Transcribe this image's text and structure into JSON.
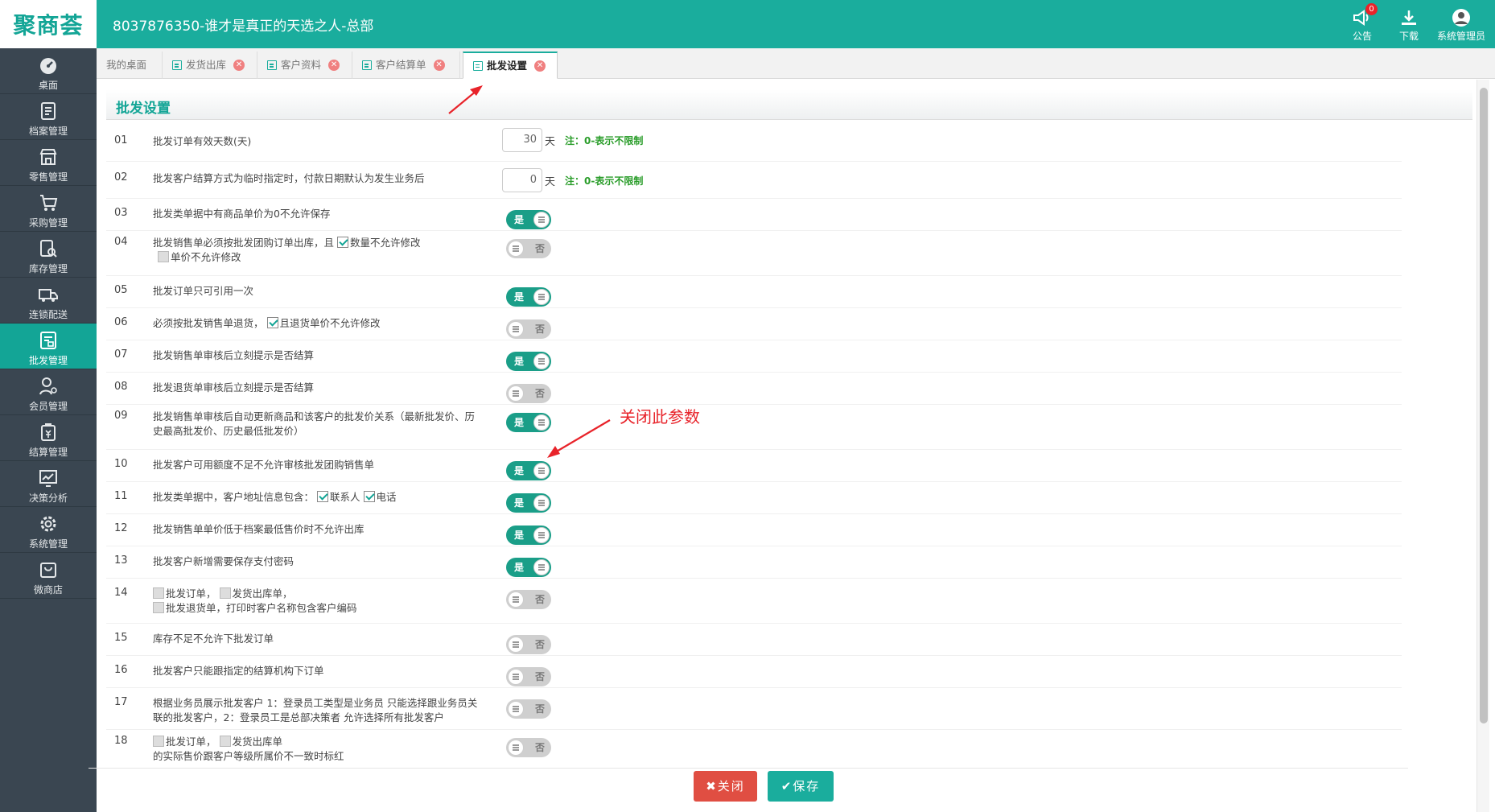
{
  "header": {
    "logo": "聚商荟",
    "company": "8037876350-谁才是真正的天选之人-总部",
    "notice_label": "公告",
    "notice_count": "0",
    "download_label": "下载",
    "user_label": "系统管理员"
  },
  "sidebar": {
    "items": [
      {
        "label": "桌面",
        "icon": "dashboard-icon"
      },
      {
        "label": "档案管理",
        "icon": "archive-icon"
      },
      {
        "label": "零售管理",
        "icon": "store-icon"
      },
      {
        "label": "采购管理",
        "icon": "cart-icon"
      },
      {
        "label": "库存管理",
        "icon": "inventory-icon"
      },
      {
        "label": "连锁配送",
        "icon": "truck-icon"
      },
      {
        "label": "批发管理",
        "icon": "wholesale-icon"
      },
      {
        "label": "会员管理",
        "icon": "member-icon"
      },
      {
        "label": "结算管理",
        "icon": "settle-icon"
      },
      {
        "label": "决策分析",
        "icon": "chart-icon"
      },
      {
        "label": "系统管理",
        "icon": "gear-icon"
      },
      {
        "label": "微商店",
        "icon": "shop-bag-icon"
      }
    ],
    "active_index": 6
  },
  "tabs": [
    {
      "label": "我的桌面",
      "closable": false
    },
    {
      "label": "发货出库",
      "closable": true
    },
    {
      "label": "客户资料",
      "closable": true
    },
    {
      "label": "客户结算单",
      "closable": true
    },
    {
      "label": "批发设置",
      "closable": true,
      "active": true
    }
  ],
  "section_title": "批发设置",
  "settings": {
    "r01": {
      "num": "01",
      "text": "批发订单有效天数(天)",
      "value": "30",
      "unit": "天",
      "note": "注：0-表示不限制"
    },
    "r02": {
      "num": "02",
      "text": "批发客户结算方式为临时指定时，付款日期默认为发生业务后",
      "value": "0",
      "unit": "天",
      "note": "注：0-表示不限制"
    },
    "r03": {
      "num": "03",
      "text": "批发类单据中有商品单价为0不允许保存",
      "state": "是"
    },
    "r04": {
      "num": "04",
      "text_a": "批发销售单必须按批发团购订单出库，且",
      "cb1": "数量不允许修改",
      "cb2": "单价不允许修改",
      "state": "否"
    },
    "r05": {
      "num": "05",
      "text": "批发订单只可引用一次",
      "state": "是"
    },
    "r06": {
      "num": "06",
      "text_a": "必须按批发销售单退货，",
      "cb1": "且退货单价不允许修改",
      "state": "否"
    },
    "r07": {
      "num": "07",
      "text": "批发销售单审核后立刻提示是否结算",
      "state": "是"
    },
    "r08": {
      "num": "08",
      "text": "批发退货单审核后立刻提示是否结算",
      "state": "否"
    },
    "r09": {
      "num": "09",
      "text": "批发销售单审核后自动更新商品和该客户的批发价关系（最新批发价、历史最高批发价、历史最低批发价）",
      "state": "是"
    },
    "r10": {
      "num": "10",
      "text": "批发客户可用额度不足不允许审核批发团购销售单",
      "state": "是"
    },
    "r11": {
      "num": "11",
      "text_a": "批发类单据中，客户地址信息包含：",
      "cb1": "联系人",
      "cb2": "电话",
      "state": "是"
    },
    "r12": {
      "num": "12",
      "text": "批发销售单单价低于档案最低售价时不允许出库",
      "state": "是"
    },
    "r13": {
      "num": "13",
      "text": "批发客户新增需要保存支付密码",
      "state": "是"
    },
    "r14": {
      "num": "14",
      "cb1": "批发订单，",
      "cb2": "发货出库单，",
      "cb3": "批发退货单，打印时客户名称包含客户编码",
      "state": "否"
    },
    "r15": {
      "num": "15",
      "text": "库存不足不允许下批发订单",
      "state": "否"
    },
    "r16": {
      "num": "16",
      "text": "批发客户只能跟指定的结算机构下订单",
      "state": "否"
    },
    "r17": {
      "num": "17",
      "text": "根据业务员展示批发客户 1：登录员工类型是业务员 只能选择跟业务员关联的批发客户，2：登录员工是总部决策者 允许选择所有批发客户",
      "state": "否"
    },
    "r18": {
      "num": "18",
      "cb1": "批发订单，",
      "cb2": "发货出库单",
      "text_b": "的实际售价跟客户等级所属价不一致时标红",
      "state": "否"
    }
  },
  "annotation": "关闭此参数",
  "buttons": {
    "close": "✖关闭",
    "save": "✔保存"
  },
  "colors": {
    "brand": "#1aad9d",
    "sidebar": "#3a4651",
    "danger": "#e04e42",
    "annotation": "#e8232a"
  }
}
